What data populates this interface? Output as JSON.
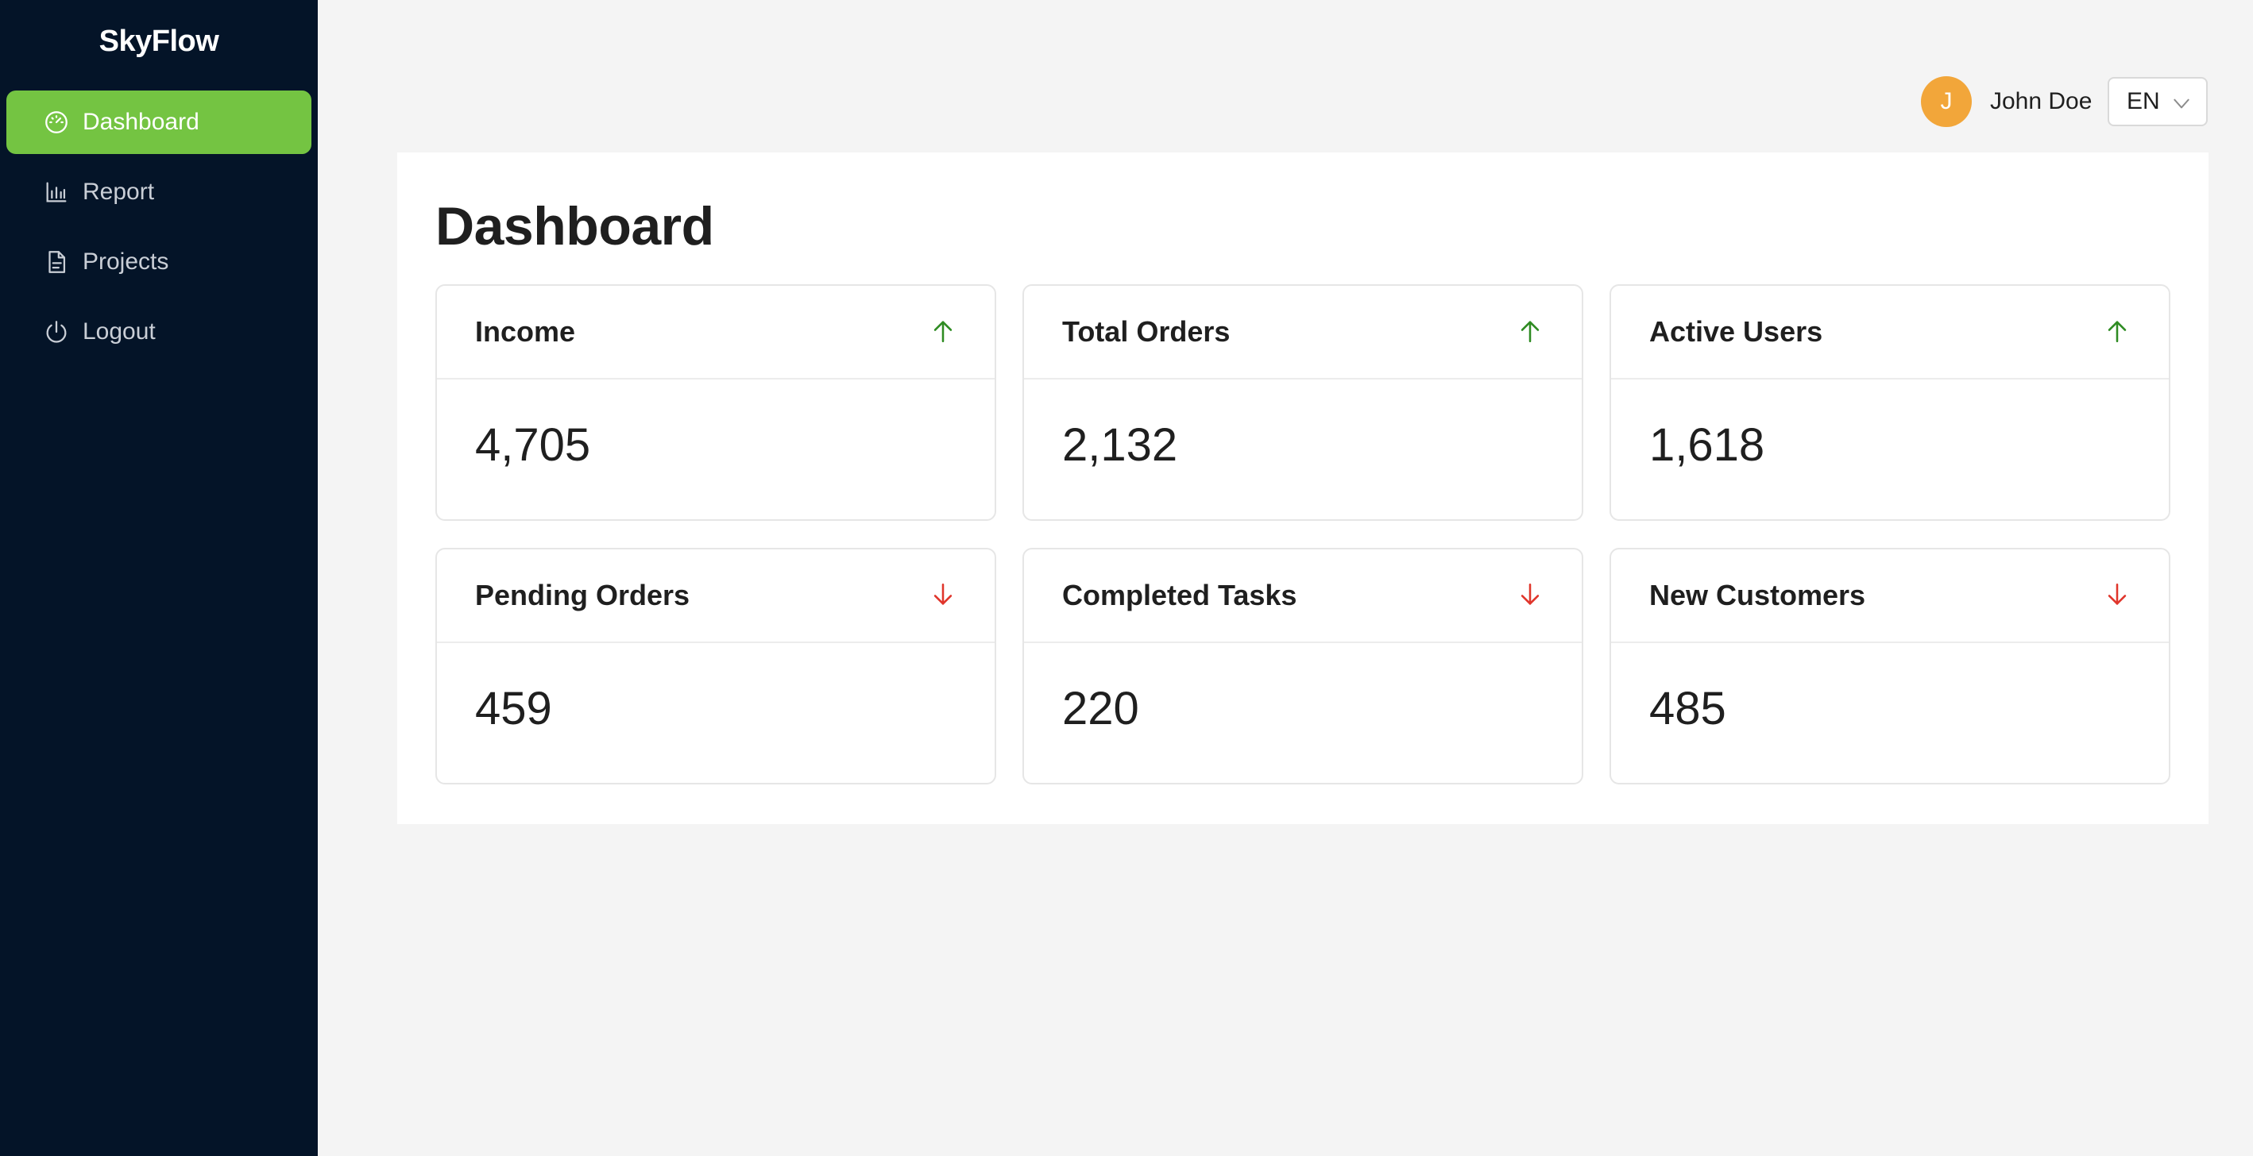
{
  "brand": "SkyFlow",
  "sidebar": {
    "items": [
      {
        "label": "Dashboard",
        "icon": "dashboard-gauge-icon",
        "active": true
      },
      {
        "label": "Report",
        "icon": "bar-chart-icon",
        "active": false
      },
      {
        "label": "Projects",
        "icon": "document-icon",
        "active": false
      },
      {
        "label": "Logout",
        "icon": "power-icon",
        "active": false
      }
    ]
  },
  "header": {
    "avatar_initial": "J",
    "user_name": "John Doe",
    "language": "EN"
  },
  "main": {
    "title": "Dashboard",
    "cards": [
      {
        "title": "Income",
        "value": "4,705",
        "trend": "up"
      },
      {
        "title": "Total Orders",
        "value": "2,132",
        "trend": "up"
      },
      {
        "title": "Active Users",
        "value": "1,618",
        "trend": "up"
      },
      {
        "title": "Pending Orders",
        "value": "459",
        "trend": "down"
      },
      {
        "title": "Completed Tasks",
        "value": "220",
        "trend": "down"
      },
      {
        "title": "New Customers",
        "value": "485",
        "trend": "down"
      }
    ]
  },
  "colors": {
    "sidebar_bg": "#041428",
    "active_item": "#74c442",
    "avatar": "#f2a63a",
    "trend_up": "#2e8b22",
    "trend_down": "#e0352b"
  }
}
